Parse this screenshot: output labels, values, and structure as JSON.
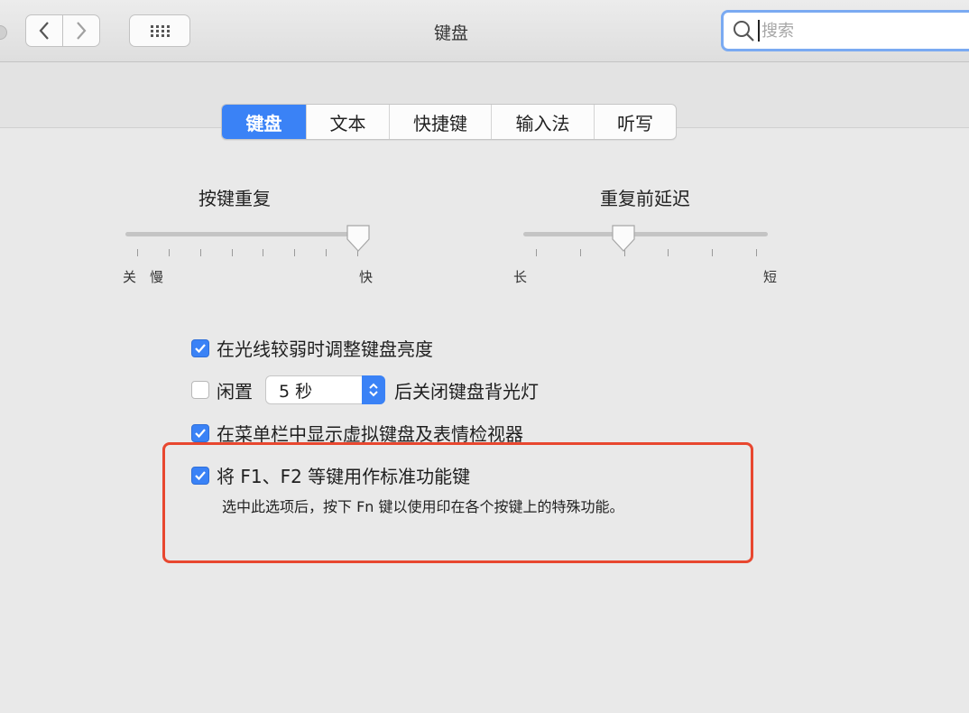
{
  "window": {
    "title": "键盘"
  },
  "toolbar": {
    "back_icon": "chevron-left-icon",
    "forward_icon": "chevron-right-icon",
    "grid_icon": "grid-dots-icon"
  },
  "search": {
    "placeholder": "搜索",
    "icon": "search-icon"
  },
  "tabs": [
    {
      "label": "键盘",
      "active": true
    },
    {
      "label": "文本",
      "active": false
    },
    {
      "label": "快捷键",
      "active": false
    },
    {
      "label": "输入法",
      "active": false
    },
    {
      "label": "听写",
      "active": false
    }
  ],
  "key_repeat": {
    "title": "按键重复",
    "label_off": "关",
    "label_slow": "慢",
    "label_fast": "快",
    "position": 1.0,
    "ticks": 8
  },
  "repeat_delay": {
    "title": "重复前延迟",
    "label_long": "长",
    "label_short": "短",
    "position": 0.4,
    "ticks": 6
  },
  "options": {
    "auto_brightness": {
      "label": "在光线较弱时调整键盘亮度",
      "checked": true
    },
    "idle_backlight": {
      "prefix": "闲置",
      "select_value": "5 秒",
      "suffix": "后关闭键盘背光灯",
      "checked": false
    },
    "show_viewer": {
      "label": "在菜单栏中显示虚拟键盘及表情检视器",
      "checked": true
    },
    "fn_keys": {
      "label": "将 F1、F2 等键用作标准功能键",
      "checked": true,
      "help": "选中此选项后，按下 Fn 键以使用印在各个按键上的特殊功能。"
    }
  },
  "colors": {
    "accent": "#3a82f6",
    "highlight": "#e8472f",
    "search_focus": "#7aaaf2"
  }
}
